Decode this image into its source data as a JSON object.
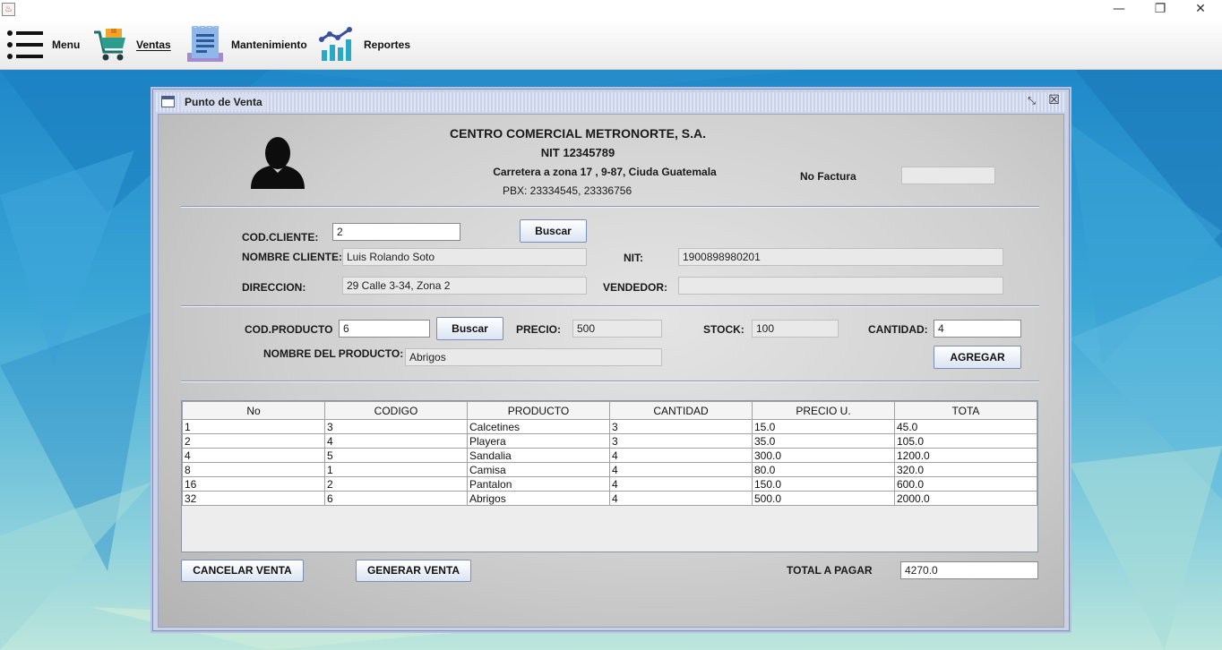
{
  "window": {
    "minimize_glyph": "—",
    "maximize_glyph": "❐",
    "close_glyph": "✕",
    "app_icon_glyph": "♨"
  },
  "menubar": {
    "items": [
      {
        "label": "Menu",
        "icon": "hamburger-icon"
      },
      {
        "label": "Ventas",
        "icon": "shopping-cart-icon"
      },
      {
        "label": "Mantenimiento",
        "icon": "document-list-icon"
      },
      {
        "label": "Reportes",
        "icon": "chart-icon"
      }
    ]
  },
  "frame": {
    "title": "Punto de Venta",
    "iconify_glyph": "⤡",
    "close_glyph": "☒"
  },
  "company": {
    "name": "CENTRO COMERCIAL METRONORTE, S.A.",
    "nit": "NIT 12345789",
    "address": "Carretera a zona 17 , 9-87, Ciuda Guatemala",
    "phones": "PBX: 23334545, 23336756"
  },
  "invoice": {
    "label": "No Factura",
    "value": ""
  },
  "client": {
    "code_label": "COD.CLIENTE:",
    "code_value": "2",
    "search_button": "Buscar",
    "name_label": "NOMBRE CLIENTE:",
    "name_value": "Luis Rolando Soto",
    "nit_label": "NIT:",
    "nit_value": "1900898980201",
    "address_label": "DIRECCION:",
    "address_value": "29 Calle 3-34, Zona 2",
    "seller_label": "VENDEDOR:",
    "seller_value": ""
  },
  "product": {
    "code_label": "COD.PRODUCTO",
    "code_value": "6",
    "search_button": "Buscar",
    "price_label": "PRECIO:",
    "price_value": "500",
    "stock_label": "STOCK:",
    "stock_value": "100",
    "qty_label": "CANTIDAD:",
    "qty_value": "4",
    "name_label": "NOMBRE DEL PRODUCTO:",
    "name_value": "Abrigos",
    "add_button": "AGREGAR"
  },
  "table": {
    "columns": [
      "No",
      "CODIGO",
      "PRODUCTO",
      "CANTIDAD",
      "PRECIO U.",
      "TOTA"
    ],
    "rows": [
      [
        "1",
        "3",
        "Calcetines",
        "3",
        "15.0",
        "45.0"
      ],
      [
        "2",
        "4",
        "Playera",
        "3",
        "35.0",
        "105.0"
      ],
      [
        "4",
        "5",
        "Sandalia",
        "4",
        "300.0",
        "1200.0"
      ],
      [
        "8",
        "1",
        "Camisa",
        "4",
        "80.0",
        "320.0"
      ],
      [
        "16",
        "2",
        "Pantalon",
        "4",
        "150.0",
        "600.0"
      ],
      [
        "32",
        "6",
        "Abrigos",
        "4",
        "500.0",
        "2000.0"
      ]
    ]
  },
  "footer": {
    "cancel_button": "CANCELAR VENTA",
    "generate_button": "GENERAR VENTA",
    "total_label": "TOTAL A PAGAR",
    "total_value": "4270.0"
  }
}
